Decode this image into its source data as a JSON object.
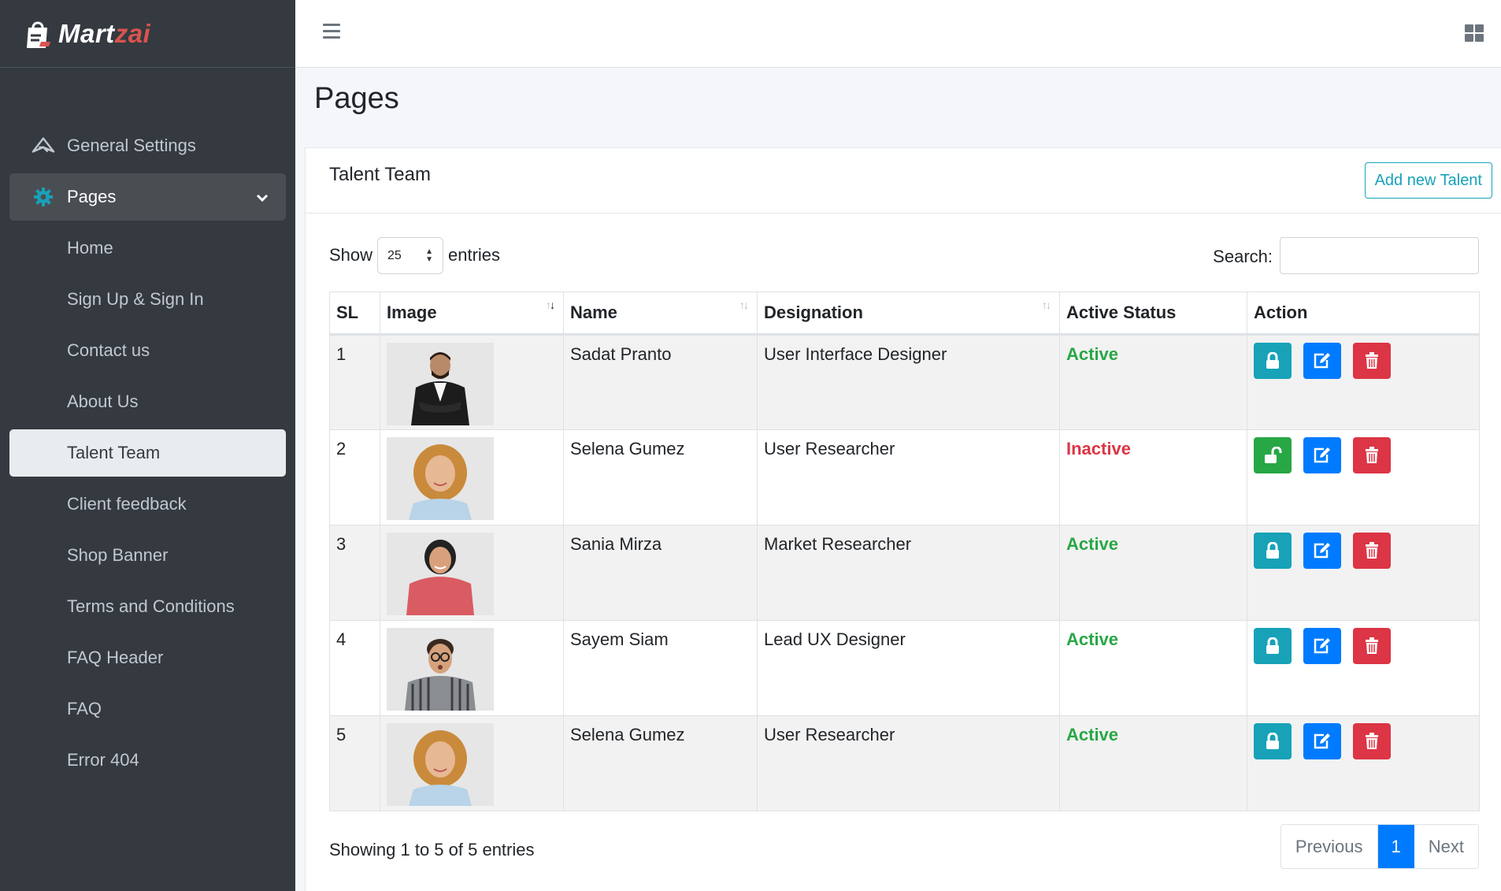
{
  "brand": {
    "name_main": "Mart",
    "name_accent": "zai"
  },
  "sidebar": {
    "items": [
      {
        "label": "General Settings",
        "icon": "paper-plane-icon"
      },
      {
        "label": "Pages",
        "icon": "gear-icon"
      }
    ],
    "sub_items": [
      {
        "label": "Home"
      },
      {
        "label": "Sign Up & Sign In"
      },
      {
        "label": "Contact us"
      },
      {
        "label": "About Us"
      },
      {
        "label": "Talent Team"
      },
      {
        "label": "Client feedback"
      },
      {
        "label": "Shop Banner"
      },
      {
        "label": "Terms and Conditions"
      },
      {
        "label": "FAQ Header"
      },
      {
        "label": "FAQ"
      },
      {
        "label": "Error 404"
      }
    ],
    "active_item": "Talent Team"
  },
  "page": {
    "title": "Pages"
  },
  "card": {
    "title": "Talent Team",
    "add_button": "Add new Talent"
  },
  "table_controls": {
    "show_label": "Show",
    "page_length": "25",
    "entries_label": "entries",
    "search_label": "Search:",
    "search_value": ""
  },
  "table": {
    "headers": [
      "SL",
      "Image",
      "Name",
      "Designation",
      "Active Status",
      "Action"
    ],
    "rows": [
      {
        "sl": "1",
        "name": "Sadat Pranto",
        "designation": "User Interface Designer",
        "status": "Active"
      },
      {
        "sl": "2",
        "name": "Selena Gumez",
        "designation": "User Researcher",
        "status": "Inactive"
      },
      {
        "sl": "3",
        "name": "Sania Mirza",
        "designation": "Market Researcher",
        "status": "Active"
      },
      {
        "sl": "4",
        "name": "Sayem Siam",
        "designation": "Lead UX Designer",
        "status": "Active"
      },
      {
        "sl": "5",
        "name": "Selena Gumez",
        "designation": "User Researcher",
        "status": "Active"
      }
    ]
  },
  "footer": {
    "info": "Showing 1 to 5 of 5 entries",
    "prev": "Previous",
    "current": "1",
    "next": "Next"
  },
  "colors": {
    "sidebar_bg": "#343a40",
    "active": "#28a745",
    "inactive": "#dc3545",
    "primary": "#007bff",
    "info": "#17a2b8"
  }
}
